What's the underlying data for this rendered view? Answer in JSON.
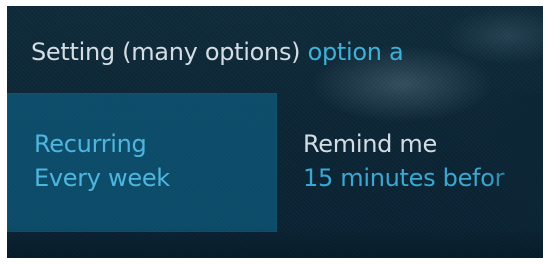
{
  "header": {
    "label": "Setting (many options)",
    "value": "option a"
  },
  "options": [
    {
      "title": "Recurring",
      "subtitle": "Every week"
    },
    {
      "title": "Remind me",
      "subtitle": "15 minutes befor"
    }
  ]
}
